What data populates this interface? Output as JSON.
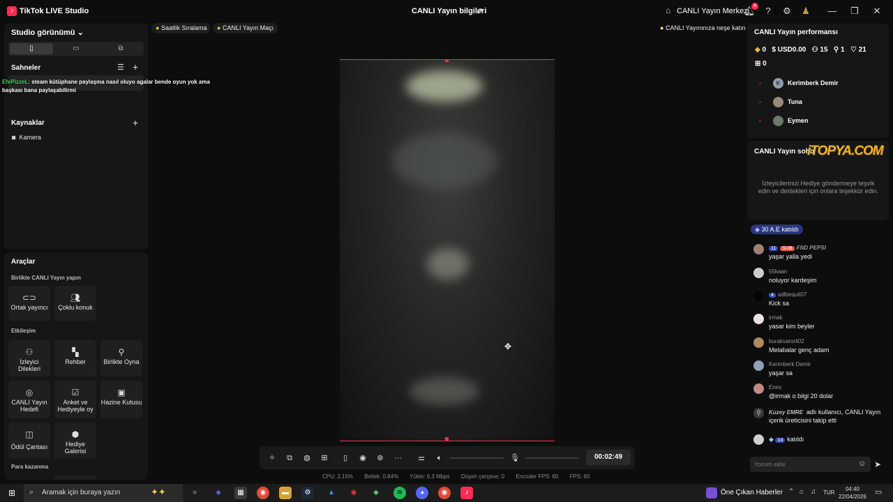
{
  "titlebar": {
    "app_name": "TikTok LIVE Studio",
    "center_title": "CANLI Yayın bilgileri",
    "center_link": "CANLI Yayın Merkezi",
    "notif_count": "4"
  },
  "left": {
    "studio_view": "Studio görünümü",
    "scenes_title": "Sahneler",
    "overlay_name": "EfePizzeL:",
    "overlay_line1": "steam kütüphane paylaşma nasıl oluyo agalar bende oyun yok ama",
    "overlay_line2": "başkası bana paylaşabilirmi",
    "sources_title": "Kaynaklar",
    "camera_label": "Kamera",
    "tools_title": "Araçlar",
    "tools_sub1": "Birlikte CANLI Yayın yapın",
    "tools_sub2": "Etkileşim",
    "tools_sub3": "Para kazanma",
    "tools": [
      {
        "label": "Ortak yayıncı",
        "icon": "link-icon"
      },
      {
        "label": "Çoklu konuk",
        "icon": "users-icon"
      },
      {
        "label": "İzleyici Dilekleri",
        "icon": "viewers-icon"
      },
      {
        "label": "Rehber",
        "icon": "guide-icon"
      },
      {
        "label": "Birlikte Oyna",
        "icon": "play-together-icon"
      },
      {
        "label": "CANLI Yayın Hedefi",
        "icon": "goal-icon"
      },
      {
        "label": "Anket ve Hediyeyle oy",
        "icon": "poll-icon"
      },
      {
        "label": "Hazine Kutusu",
        "icon": "chest-icon"
      },
      {
        "label": "Ödül Çantası",
        "icon": "bag-icon"
      },
      {
        "label": "Hediye Galerisi",
        "icon": "gallery-icon"
      }
    ]
  },
  "center": {
    "pill1": "Saatlik Sıralama",
    "pill2": "CANLI Yayın Maçı",
    "pill3": "CANLI Yayınınıza neşe katın",
    "timer": "00:02:49",
    "stats": [
      "CPU: 2.15%",
      "Bellek: 0.84%",
      "Yükle: 6.3 Mbps",
      "Düşen çerçeve: 0",
      "Encoder FPS: 60",
      "FPS: 60"
    ]
  },
  "right": {
    "perf_title": "CANLI Yayın performansı",
    "metrics": {
      "gems": "0",
      "usd": "USD0.00",
      "viewers": "15",
      "followers": "1",
      "likes": "21",
      "gifts": "0"
    },
    "top_viewers": [
      "Kerimberk Demir",
      "Tuna",
      "Eymen"
    ],
    "chat_title": "CANLI Yayın sohb",
    "watermark": "iTOPYA.COM",
    "chat_hint": "İzleyicilerinizi Hediye göndermeye teşvik edin ve destekleri için onlara teşekkür edin.",
    "join_badge_level": "30",
    "join_badge_text": "A.E katıldı",
    "messages": [
      {
        "level": "11",
        "sub": "SUB",
        "name": "FND PEPSI",
        "text": "yaşar yalla yedi"
      },
      {
        "level": "",
        "sub": "",
        "name": "55kaan",
        "text": "noluyor kardeşim"
      },
      {
        "level": "4",
        "sub": "",
        "name": "adlbequit07",
        "text": "Kick sa"
      },
      {
        "level": "",
        "sub": "",
        "name": "irmak",
        "text": "yasar kim beyler"
      },
      {
        "level": "",
        "sub": "",
        "name": "burakvaroi402",
        "text": "Melabalar genç adam"
      },
      {
        "level": "",
        "sub": "",
        "name": "Kerimberk Demir",
        "text": "yaşar sa"
      },
      {
        "level": "",
        "sub": "",
        "name": "Enes",
        "text": "@irmak o bilgi 20 dolar"
      }
    ],
    "follow_name": "Kuzey EMRE",
    "follow_text1": "adlı kullanıcı, CANLI Yayın",
    "follow_text2": "içerik üreticisini takip etti",
    "join2_level": "14",
    "join2_text": "katıldı",
    "comment_placeholder": "Yorum ekle"
  },
  "taskbar": {
    "search_placeholder": "Aramak için buraya yazın",
    "news": "Öne Çıkan Haberler",
    "lang": "TUR",
    "time": "04:40",
    "date": "22/04/2026"
  }
}
